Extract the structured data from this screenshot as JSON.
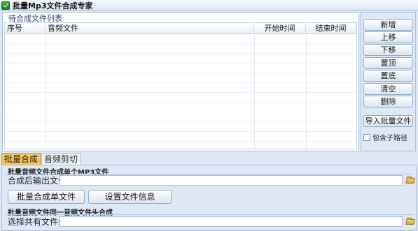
{
  "window": {
    "title": "批量Mp3文件合成专家"
  },
  "file_list": {
    "caption": "待合成文件列表",
    "columns": [
      "序号",
      "音频文件",
      "开始时间",
      "结束时间"
    ],
    "rows": []
  },
  "side_buttons": [
    "新增",
    "上移",
    "下移",
    "置顶",
    "置底",
    "清空",
    "删除"
  ],
  "import_button": "导入批量文件",
  "include_subpath": {
    "label": "包含子路径",
    "checked": false
  },
  "tabs": [
    {
      "label": "批量合成",
      "active": true
    },
    {
      "label": "音频剪切",
      "active": false
    }
  ],
  "merge_single": {
    "section_title": "批量音频文件合成单个MP3文件",
    "output_label": "合成后输出文件",
    "output_value": "",
    "merge_button": "批量合成单文件",
    "info_button": "设置文件信息"
  },
  "merge_header": {
    "section_title": "批量音频文件同一音频文件头合成",
    "shared_label": "选择共有文件头",
    "shared_value": ""
  },
  "icons": {
    "app": "app-logo-icon",
    "browse": "folder-icon"
  },
  "colors": {
    "background": "#dfe8f6",
    "active_tab": "#f7c659",
    "border": "#a9bfd6"
  }
}
